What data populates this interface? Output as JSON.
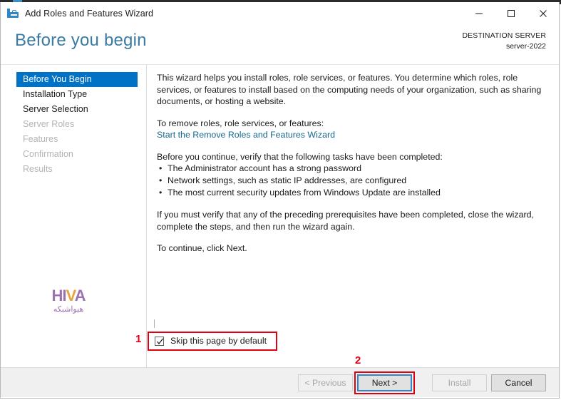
{
  "window": {
    "title": "Add Roles and Features Wizard",
    "icon": "toolbox-icon",
    "minimize_label": "Minimize",
    "maximize_label": "Maximize",
    "close_label": "Close"
  },
  "header": {
    "page_title": "Before you begin",
    "destination_label": "DESTINATION SERVER",
    "destination_value": "server-2022"
  },
  "sidebar": {
    "items": [
      {
        "label": "Before You Begin",
        "state": "selected"
      },
      {
        "label": "Installation Type",
        "state": "enabled"
      },
      {
        "label": "Server Selection",
        "state": "enabled"
      },
      {
        "label": "Server Roles",
        "state": "disabled"
      },
      {
        "label": "Features",
        "state": "disabled"
      },
      {
        "label": "Confirmation",
        "state": "disabled"
      },
      {
        "label": "Results",
        "state": "disabled"
      }
    ],
    "logo": {
      "mark_part1": "HI",
      "mark_accent": "V",
      "mark_part2": "A",
      "subtitle": "هیواشبکه"
    }
  },
  "content": {
    "paragraph1": "This wizard helps you install roles, role services, or features. You determine which roles, role services, or features to install based on the computing needs of your organization, such as sharing documents, or hosting a website.",
    "paragraph2": "To remove roles, role services, or features:",
    "remove_link": "Start the Remove Roles and Features Wizard",
    "paragraph3": "Before you continue, verify that the following tasks have been completed:",
    "bullets": [
      "The Administrator account has a strong password",
      "Network settings, such as static IP addresses, are configured",
      "The most current security updates from Windows Update are installed"
    ],
    "paragraph4": "If you must verify that any of the preceding prerequisites have been completed, close the wizard, complete the steps, and then run the wizard again.",
    "paragraph5": "To continue, click Next."
  },
  "checkbox": {
    "label": "Skip this page by default",
    "checked": true,
    "annotation_number": "1"
  },
  "footer": {
    "previous_label": "< Previous",
    "next_label": "Next >",
    "install_label": "Install",
    "cancel_label": "Cancel",
    "next_annotation_number": "2"
  },
  "colors": {
    "accent_blue": "#0072c6",
    "title_blue": "#3a7ba4",
    "link_blue": "#15688f",
    "annotation_red": "#e00012",
    "logo_purple": "#9a72b0",
    "logo_orange": "#e8a33d"
  }
}
